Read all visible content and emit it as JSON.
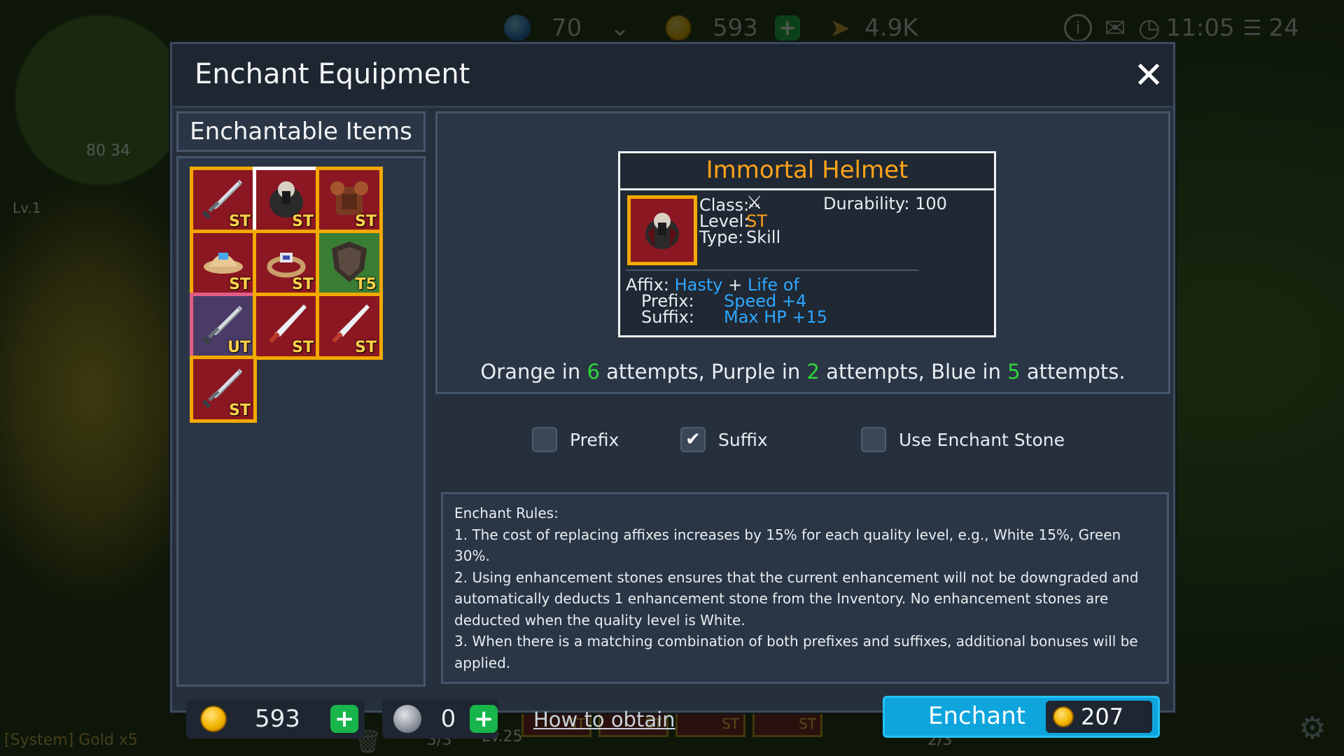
{
  "topbar": {
    "gems": "70",
    "gold": "593",
    "wings": "4.9K",
    "time": "11:05",
    "signal": "24"
  },
  "background": {
    "minimap_coords": "80 34",
    "player_level": "Lv.1",
    "system_msg": "[System] Gold x5",
    "potions": "3/3",
    "hero_level": "Lv.25",
    "right_count": "2/3",
    "hotbar_labels": [
      "ST",
      "ST",
      "ST",
      "ST"
    ]
  },
  "dialog": {
    "title": "Enchant Equipment",
    "list_title": "Enchantable Items",
    "items": [
      {
        "name": "sword-item",
        "tier": "ST",
        "border": "#f2a900",
        "bg": "#8b1722",
        "selected": false
      },
      {
        "name": "helmet-item",
        "tier": "ST",
        "border": "#ffffff",
        "bg": "#8b1722",
        "selected": true
      },
      {
        "name": "armor-item",
        "tier": "ST",
        "border": "#f2a900",
        "bg": "#8b1722",
        "selected": false
      },
      {
        "name": "cap-item",
        "tier": "ST",
        "border": "#f2a900",
        "bg": "#8b1722",
        "selected": false
      },
      {
        "name": "ring-item",
        "tier": "ST",
        "border": "#f2a900",
        "bg": "#8b1722",
        "selected": false
      },
      {
        "name": "shield-item",
        "tier": "T5",
        "border": "#f2a900",
        "bg": "#3a7d35",
        "selected": false
      },
      {
        "name": "sword-item",
        "tier": "UT",
        "border": "#e25d86",
        "bg": "#4a3a66",
        "selected": false
      },
      {
        "name": "blade-item",
        "tier": "ST",
        "border": "#f2a900",
        "bg": "#8b1722",
        "selected": false
      },
      {
        "name": "blade-item",
        "tier": "ST",
        "border": "#f2a900",
        "bg": "#8b1722",
        "selected": false
      },
      {
        "name": "sword-item",
        "tier": "ST",
        "border": "#f2a900",
        "bg": "#8b1722",
        "selected": false
      }
    ],
    "card": {
      "name": "Immortal Helmet",
      "class_label": "Class:",
      "level_label": "Level:",
      "level_value": "ST",
      "type_label": "Type:",
      "type_value": "Skill",
      "durability": "Durability: 100",
      "affix_label": "Affix:",
      "affix_prefix": "Hasty",
      "affix_plus": "+",
      "affix_suffix": "Life of",
      "prefix_label": "Prefix:",
      "prefix_value": "Speed +4",
      "suffix_label": "Suffix:",
      "suffix_value": "Max HP +15"
    },
    "attempts": {
      "t1": "Orange in ",
      "n1": "6",
      "t2": " attempts, Purple in ",
      "n2": "2",
      "t3": " attempts, Blue in ",
      "n3": "5",
      "t4": " attempts."
    },
    "options": {
      "prefix_label": "Prefix",
      "prefix_checked": false,
      "suffix_label": "Suffix",
      "suffix_checked": true,
      "stone_label": "Use Enchant Stone",
      "stone_checked": false
    },
    "rules": {
      "title": "Enchant Rules:",
      "r1": "1. The cost of replacing affixes increases by 15% for each quality level, e.g., White 15%, Green 30%.",
      "r2": "2. Using enhancement stones ensures that the current enhancement will not be downgraded and automatically deducts 1 enhancement stone from the Inventory. No enhancement stones are deducted when the quality level is White.",
      "r3": "3. When there is a matching combination of both prefixes and suffixes, additional bonuses will be applied."
    },
    "footer": {
      "gold": "593",
      "stones": "0",
      "how_to_obtain": "How to obtain",
      "enchant_label": "Enchant",
      "enchant_cost": "207"
    }
  },
  "colors": {
    "accent_orange": "#ffa31a",
    "affix_blue": "#2ea7ff",
    "number_green": "#2fd63a",
    "enchant_button": "#0ea5dc"
  }
}
